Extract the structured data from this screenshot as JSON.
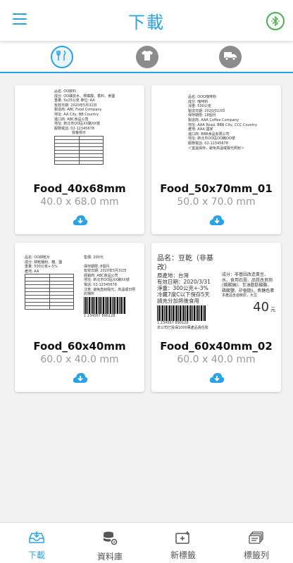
{
  "appbar": {
    "title": "下載",
    "menu_icon": "menu-icon",
    "bluetooth_icon": "bluetooth-icon"
  },
  "categories": [
    {
      "icon": "utensils-icon",
      "active": true
    },
    {
      "icon": "tshirt-icon",
      "active": false
    },
    {
      "icon": "truck-icon",
      "active": false
    }
  ],
  "cards": [
    {
      "name": "Food_40x68mm",
      "size": "40.0 x 68.0 mm",
      "thumb": [
        "品名: OO飲料",
        "成分: OO礦泉水、檸檬酸、香料、食鹽",
        "重量: 5x25公克  單位: AA",
        "有效日期: 2020年5月31日",
        "製造商: ABC Food Company",
        "地址: AA City, BB Country",
        "進口商: ABC食品公司",
        "地址: 新北市OO區XX路XX號",
        "服務電話: 02-12345678",
        "營養標示"
      ]
    },
    {
      "name": "Food_50x70mm_01",
      "size": "50.0 x 70.0 mm",
      "thumb": [
        "品名: OOO咖啡粉",
        "成分: 咖啡粉",
        "淨重: 500公克",
        "製造日期: 2020/01/03",
        "保存期限: 18個月",
        "製造商: AAA Coffee Company",
        "地址: AAA Road, BBB City, CCC Country",
        "產地: AAA 國家",
        "進口商: BBB食品有限公司",
        "地址: 新北市OO區OO路OO號",
        "服務電話: 02-12345678",
        "＜室溫保存，避免高溫或陽光照射＞"
      ]
    },
    {
      "name": "Food_60x40mm",
      "size": "60.0 x 40.0 mm",
      "thumb": [
        "品名: OO餅乾片",
        "成分: 餅乾麵粉、糖、鹽",
        "重量: 500公克+-5%",
        "產地: AA",
        "售價: 200元",
        "保存期限: 8個月",
        "有效日期: 2020年5月31日",
        "經銷商: ABC食品公司",
        "地址: 新北市OO區XX路XX號",
        "電話: 02-12345678",
        "注意: 避免直射陽光，高溫或日照的場所",
        "1 234567 890128"
      ]
    },
    {
      "name": "Food_60x40mm_02",
      "size": "60.0 x 40.0 mm",
      "thumb": [
        "品名：豆乾（非基改）",
        "原產地：台灣",
        "有效日期：2020/3/31",
        "淨重：300公克+-3%",
        "冷藏7度C以下保存5天",
        "請充分加熱後食用",
        "成分：非基因改造黃豆、水、食用石膏、品質改良劑(碳酸鈉)、甘油脂肪酸酯、磷酸鹽、矽樹脂)，焦糖色素",
        "本產品含過敏原，大豆",
        "40",
        "元",
        "本公司已投保1000萬產品責任險",
        "1 234567 890128"
      ]
    }
  ],
  "bottom_nav": [
    {
      "label": "下載",
      "icon": "download-tray-icon",
      "active": true
    },
    {
      "label": "資料庫",
      "icon": "database-settings-icon",
      "active": false
    },
    {
      "label": "新標籤",
      "icon": "new-label-icon",
      "active": false
    },
    {
      "label": "標籤列",
      "icon": "label-list-icon",
      "active": false
    }
  ],
  "colors": {
    "accent": "#29a3e6",
    "bluetooth": "#4caf50",
    "inactive_icon": "#8c8c8c"
  }
}
